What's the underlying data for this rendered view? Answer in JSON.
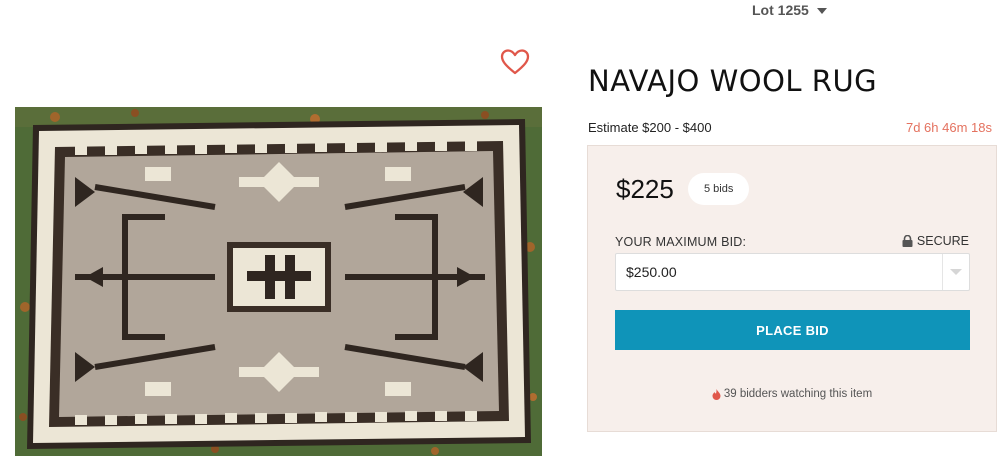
{
  "lot": {
    "label": "Lot 1255"
  },
  "item": {
    "title": "NAVAJO WOOL RUG",
    "estimate": "Estimate $200 - $400",
    "time_left": "7d  6h  46m  18s"
  },
  "bidding": {
    "current_price": "$225",
    "bid_count": "5 bids",
    "max_bid_label": "YOUR MAXIMUM BID:",
    "secure_label": "SECURE",
    "max_bid_value": "$250.00",
    "place_bid_label": "PLACE BID",
    "watchers_text": "39 bidders watching this item"
  },
  "icons": {
    "favorite": "heart-icon",
    "lot_dropdown": "chevron-down-icon",
    "secure": "lock-icon",
    "watchers": "fire-icon",
    "bid_dropdown": "chevron-down-icon"
  },
  "colors": {
    "accent": "#0f94b9",
    "heart": "#e0574a",
    "countdown": "#e4725f",
    "panel_bg": "#f7efeb"
  }
}
